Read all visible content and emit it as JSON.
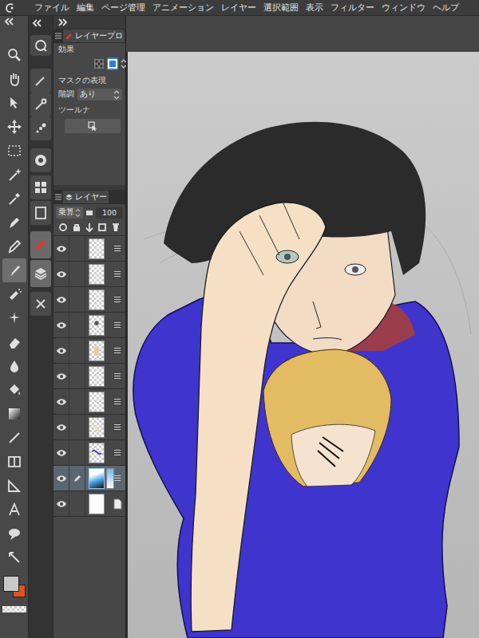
{
  "menu": [
    "ファイル",
    "編集",
    "ページ管理",
    "アニメーション",
    "レイヤー",
    "選択範囲",
    "表示",
    "フィルター",
    "ウィンドウ",
    "ヘルプ"
  ],
  "tools": [
    {
      "selected": false
    },
    {
      "selected": false
    },
    {
      "selected": false
    },
    {
      "selected": false
    },
    {
      "selected": false
    },
    {
      "selected": false
    },
    {
      "selected": false
    },
    {
      "selected": false
    },
    {
      "selected": false
    },
    {
      "selected": true
    },
    {
      "selected": false
    },
    {
      "selected": false
    },
    {
      "selected": false
    },
    {
      "selected": false
    },
    {
      "selected": false
    },
    {
      "selected": false
    },
    {
      "selected": false
    },
    {
      "selected": false
    },
    {
      "selected": false
    },
    {
      "selected": false
    },
    {
      "selected": false
    },
    {
      "selected": false
    }
  ],
  "panel_buttons": [
    {
      "selected": false
    },
    {
      "selected": false
    },
    {
      "selected": false
    },
    {
      "selected": false
    },
    {
      "selected": false
    },
    {
      "selected": false
    },
    {
      "selected": false
    },
    {
      "selected": true
    },
    {
      "selected": true
    },
    {
      "selected": false
    }
  ],
  "layer_property": {
    "tab": "レイヤープロ",
    "effect_label": "効果",
    "effects": [
      {
        "selected": false
      },
      {
        "selected": true
      }
    ],
    "mask_label": "マスクの表現",
    "gradation_label": "階調",
    "gradation_value": "あり",
    "toolnavi_label": "ツールナ"
  },
  "layer_panel": {
    "tab": "レイヤー",
    "blend_mode": "乗算",
    "opacity": "100",
    "layers": [
      {
        "kind": "raster",
        "visible": true,
        "selected": false
      },
      {
        "kind": "raster",
        "visible": true,
        "selected": false
      },
      {
        "kind": "raster",
        "visible": true,
        "selected": false
      },
      {
        "kind": "raster",
        "visible": true,
        "selected": false
      },
      {
        "kind": "raster",
        "visible": true,
        "selected": false
      },
      {
        "kind": "raster",
        "visible": true,
        "selected": false
      },
      {
        "kind": "raster",
        "visible": true,
        "selected": false
      },
      {
        "kind": "raster",
        "visible": true,
        "selected": false
      },
      {
        "kind": "raster",
        "visible": true,
        "selected": false
      },
      {
        "kind": "mask",
        "visible": true,
        "selected": true
      },
      {
        "kind": "paper",
        "visible": true,
        "selected": false
      }
    ]
  },
  "colors": {
    "main": {
      "color": "#c8c8c8"
    },
    "sub": {
      "color": "#e4521c"
    }
  }
}
